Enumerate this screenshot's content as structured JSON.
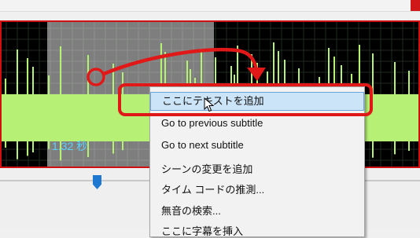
{
  "waveform": {
    "time_label": "1.32 秒",
    "colors": {
      "background": "#000000",
      "selection": "#e6e6e6",
      "wave": "#b6f075",
      "time_label": "#5ad2ff",
      "highlight": "#e01818"
    }
  },
  "context_menu": {
    "items": [
      {
        "label": "ここにテキストを追加",
        "highlighted": true
      },
      {
        "label": "Go to previous subtitle"
      },
      {
        "label": "Go to next subtitle"
      },
      {
        "label": "シーンの変更を追加"
      },
      {
        "label": "タイム コードの推測..."
      },
      {
        "label": "無音の検索..."
      },
      {
        "label": "ここに字幕を挿入"
      }
    ]
  },
  "icons": {
    "cursor": "mouse-pointer-icon",
    "arrow": "annotation-arrow-icon",
    "origin": "annotation-circle-icon"
  }
}
